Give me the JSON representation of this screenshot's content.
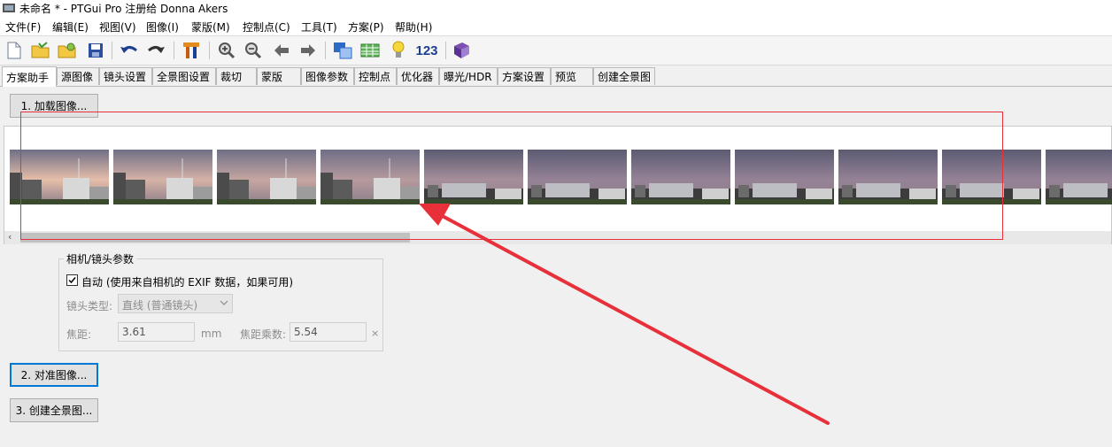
{
  "window": {
    "title": "未命名 * - PTGui Pro 注册给 Donna Akers"
  },
  "menu": [
    "文件(F)",
    "编辑(E)",
    "视图(V)",
    "图像(I)",
    "蒙版(M)",
    "控制点(C)",
    "工具(T)",
    "方案(P)",
    "帮助(H)"
  ],
  "toolbar": {
    "icons": [
      "new-file-icon",
      "open-folder-icon",
      "open-recent-icon",
      "save-icon",
      "undo-icon",
      "redo-icon",
      "tools-icon",
      "zoom-in-icon",
      "zoom-out-icon",
      "back-icon",
      "forward-icon",
      "panorama-editor-icon",
      "table-icon",
      "lightbulb-icon",
      "numbers-icon",
      "book-icon"
    ],
    "numbers_label": "123"
  },
  "tabs": [
    "方案助手",
    "源图像",
    "镜头设置",
    "全景图设置",
    "裁切",
    "蒙版",
    "图像参数",
    "控制点",
    "优化器",
    "曝光/HDR",
    "方案设置",
    "预览",
    "创建全景图"
  ],
  "active_tab": "方案助手",
  "steps": {
    "load": "1. 加载图像...",
    "align": "2. 对准图像...",
    "create": "3. 创建全景图..."
  },
  "thumbnail_count": 11,
  "camera_group": {
    "title": "相机/镜头参数",
    "auto_label": "自动 (使用来自相机的 EXIF 数据，如果可用)",
    "auto_checked": true,
    "lens_type_label": "镜头类型:",
    "lens_type_value": "直线 (普通镜头)",
    "focal_label": "焦距:",
    "focal_value": "3.61",
    "focal_unit": "mm",
    "crop_label": "焦距乘数:",
    "crop_value": "5.54",
    "crop_suffix": "×"
  },
  "colors": {
    "annotation_red": "#e8303a",
    "focus_blue": "#0078d7"
  }
}
